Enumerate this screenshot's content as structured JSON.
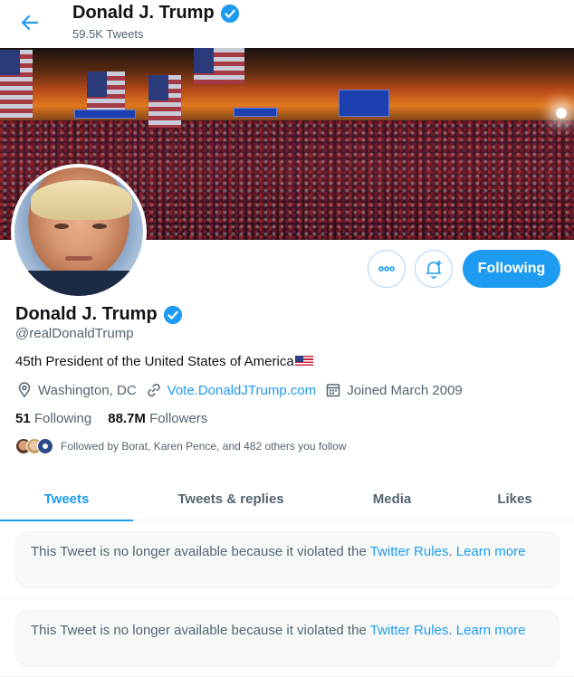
{
  "header": {
    "title": "Donald J. Trump",
    "tweet_count": "59.5K Tweets"
  },
  "profile": {
    "name": "Donald J. Trump",
    "handle": "@realDonaldTrump",
    "bio": "45th President of the United States of America",
    "location": "Washington, DC",
    "website": "Vote.DonaldJTrump.com",
    "joined": "Joined March 2009",
    "following_count": "51",
    "following_label": "Following",
    "followers_count": "88.7M",
    "followers_label": "Followers",
    "followed_by": "Followed by Borat, Karen Pence, and 482 others you follow"
  },
  "actions": {
    "follow_label": "Following"
  },
  "tabs": [
    {
      "label": "Tweets",
      "active": true
    },
    {
      "label": "Tweets & replies",
      "active": false
    },
    {
      "label": "Media",
      "active": false
    },
    {
      "label": "Likes",
      "active": false
    }
  ],
  "tweets": [
    {
      "notice": "This Tweet is no longer available because it violated the ",
      "link": "Twitter Rules",
      "after": ". ",
      "learn_more": "Learn more"
    },
    {
      "notice": "This Tweet is no longer available because it violated the ",
      "link": "Twitter Rules",
      "after": ". ",
      "learn_more": "Learn more"
    }
  ],
  "colors": {
    "accent": "#1d9bf0",
    "text_primary": "#0f1419",
    "text_secondary": "#536471"
  },
  "icons": [
    "back-arrow-icon",
    "verified-badge-icon",
    "more-icon",
    "notification-bell-icon",
    "location-icon",
    "link-icon",
    "calendar-icon"
  ]
}
